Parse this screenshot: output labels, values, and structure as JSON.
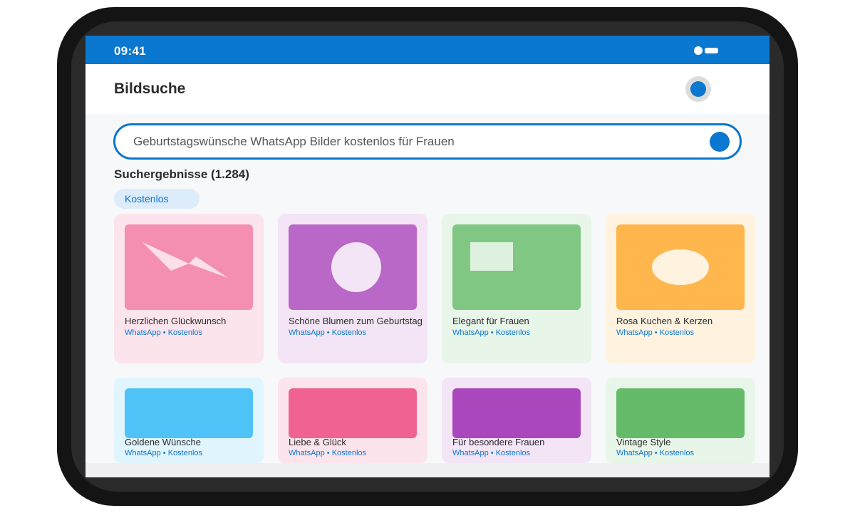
{
  "status_bar": {
    "time": "09:41"
  },
  "header": {
    "title": "Bildsuche"
  },
  "search": {
    "query": "Geburtstagswünsche WhatsApp Bilder kostenlos für Frauen"
  },
  "results": {
    "heading": "Suchergebnisse (1.284)"
  },
  "filters": {
    "active_chip": "Kostenlos"
  },
  "colors": {
    "accent": "#0a77d0",
    "card_pink_bg": "#fce4ec",
    "card_purple_bg": "#f3e5f5",
    "card_green_bg": "#e8f5e9",
    "card_orange_bg": "#fff3e0",
    "card_blue_bg": "#e1f5fe"
  },
  "cards": [
    {
      "title": "Herzlichen Glückwunsch",
      "meta": "WhatsApp • Kostenlos",
      "bg": "#fce4ec",
      "thumb_color": "#f48fb1"
    },
    {
      "title": "Schöne Blumen zum Geburtstag",
      "meta": "WhatsApp • Kostenlos",
      "bg": "#f3e5f5",
      "thumb_color": "#ba68c8"
    },
    {
      "title": "Elegant für Frauen",
      "meta": "WhatsApp • Kostenlos",
      "bg": "#e8f5e9",
      "thumb_color": "#81c784"
    },
    {
      "title": "Rosa Kuchen & Kerzen",
      "meta": "WhatsApp • Kostenlos",
      "bg": "#fff3e0",
      "thumb_color": "#ffb74d"
    },
    {
      "title": "Goldene Wünsche",
      "meta": "WhatsApp • Kostenlos",
      "bg": "#e1f5fe",
      "thumb_color": "#4fc3f7"
    },
    {
      "title": "Liebe & Glück",
      "meta": "WhatsApp • Kostenlos",
      "bg": "#fce4ec",
      "thumb_color": "#f06292"
    },
    {
      "title": "Für besondere Frauen",
      "meta": "WhatsApp • Kostenlos",
      "bg": "#f3e5f5",
      "thumb_color": "#ab47bc"
    },
    {
      "title": "Vintage Style",
      "meta": "WhatsApp • Kostenlos",
      "bg": "#e8f5e9",
      "thumb_color": "#66bb6a"
    }
  ]
}
